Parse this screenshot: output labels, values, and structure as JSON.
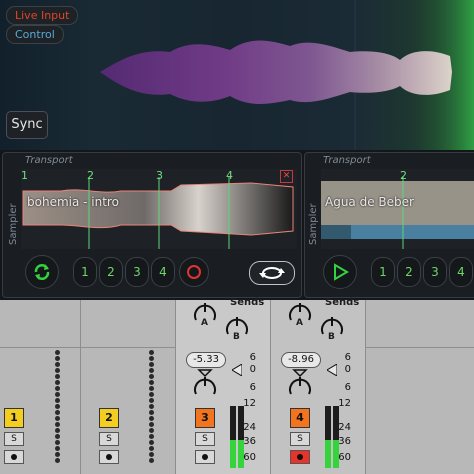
{
  "visualizer": {
    "live_input_label": "Live Input",
    "control_label": "Control",
    "sync_label": "Sync"
  },
  "decks": {
    "deck_a": {
      "transport_label": "Transport",
      "sampler_label": "Sampler",
      "track_name": "bohemia - intro",
      "markers": [
        "1",
        "2",
        "3",
        "4"
      ],
      "close_glyph": "✕",
      "hotcue_buttons": [
        "1",
        "2",
        "3",
        "4"
      ],
      "play_icon": "sync-icon",
      "record_icon": "record-icon",
      "loop_icon": "loop-icon"
    },
    "deck_b": {
      "transport_label": "Transport",
      "sampler_label": "Sampler",
      "track_name": "Agua de Beber",
      "markers": [
        "2"
      ],
      "hotcue_buttons": [
        "1",
        "2",
        "3",
        "4"
      ],
      "play_icon": "play-icon"
    }
  },
  "mixer": {
    "sends_label": "Sends",
    "knob_letters": [
      "A",
      "B"
    ],
    "tracks": [
      {
        "number": "1",
        "color": "#f3cd1f",
        "solo": "S",
        "armed": false
      },
      {
        "number": "2",
        "color": "#f3cd1f",
        "solo": "S",
        "armed": false
      },
      {
        "number": "3",
        "color": "#f2741e",
        "solo": "S",
        "armed": false,
        "volume": "-5.33"
      },
      {
        "number": "4",
        "color": "#f2741e",
        "solo": "S",
        "armed": true,
        "volume": "-8.96"
      }
    ],
    "db_scale": [
      "6",
      "0",
      "6",
      "12",
      "24",
      "36",
      "60"
    ],
    "meter_level_track3": 0.45,
    "meter_level_track4": 0.45
  }
}
